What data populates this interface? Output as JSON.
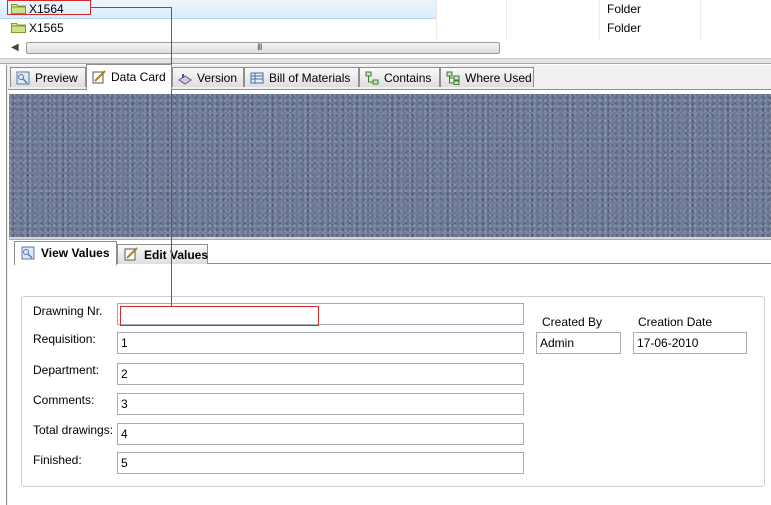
{
  "file_list": {
    "rows": [
      {
        "name": "X1564",
        "type": "Folder",
        "selected": true
      },
      {
        "name": "X1565",
        "type": "Folder",
        "selected": false
      }
    ],
    "scrollbar": {
      "grip": "III"
    }
  },
  "tabs": [
    {
      "label": "Preview",
      "icon": "preview-icon",
      "active": false
    },
    {
      "label": "Data Card",
      "icon": "data-card-icon",
      "active": true
    },
    {
      "label": "Version",
      "icon": "version-icon",
      "active": false
    },
    {
      "label": "Bill of Materials",
      "icon": "bill-of-materials-icon",
      "active": false
    },
    {
      "label": "Contains",
      "icon": "contains-icon",
      "active": false
    },
    {
      "label": "Where Used",
      "icon": "where-used-icon",
      "active": false
    }
  ],
  "subtabs": [
    {
      "label": "View Values",
      "icon": "view-values-icon",
      "active": true
    },
    {
      "label": "Edit Values",
      "icon": "edit-values-icon",
      "active": false
    }
  ],
  "form": {
    "fields": [
      {
        "label": "Drawning Nr.",
        "value": ""
      },
      {
        "label": "Requisition:",
        "value": "1"
      },
      {
        "label": "Department:",
        "value": "2"
      },
      {
        "label": "Comments:",
        "value": "3"
      },
      {
        "label": "Total drawings:",
        "value": "4"
      },
      {
        "label": "Finished:",
        "value": "5"
      }
    ],
    "created_by": {
      "label": "Created By",
      "value": "Admin"
    },
    "creation_date": {
      "label": "Creation Date",
      "value": "17-06-2010"
    }
  },
  "colors": {
    "annotation": "#d42a2a",
    "selection": "#d9ecfb",
    "preview_background": "#6d7a98"
  }
}
